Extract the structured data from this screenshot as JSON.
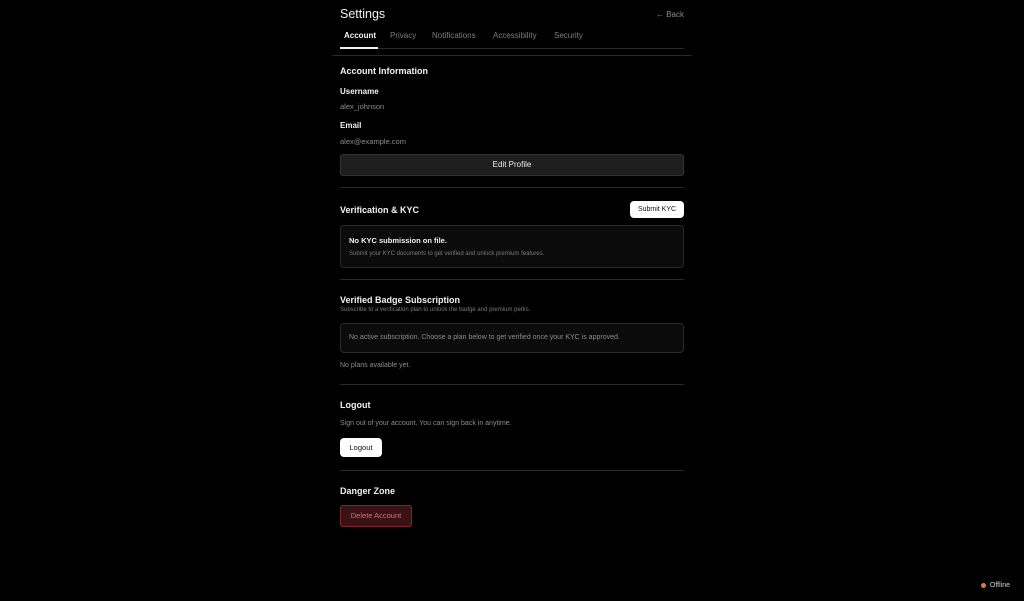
{
  "header": {
    "title": "Settings",
    "back_label": "← Back"
  },
  "tabs": [
    {
      "label": "Account",
      "active": true
    },
    {
      "label": "Privacy",
      "active": false
    },
    {
      "label": "Notifications",
      "active": false
    },
    {
      "label": "Accessibility",
      "active": false
    },
    {
      "label": "Security",
      "active": false
    }
  ],
  "account": {
    "title": "Account Information",
    "username_label": "Username",
    "username_value": "alex_johnson",
    "email_label": "Email",
    "email_value": "alex@example.com",
    "edit_button": "Edit Profile"
  },
  "kyc": {
    "title": "Verification & KYC",
    "submit_button": "Submit KYC",
    "status_title": "No KYC submission on file.",
    "status_desc": "Submit your KYC documents to get verified and unlock premium features."
  },
  "badge": {
    "title": "Verified Badge Subscription",
    "subtitle": "Subscribe to a verification plan to unlock the badge and premium perks.",
    "notice": "No active subscription. Choose a plan below to get verified once your KYC is approved.",
    "no_plans": "No plans available yet."
  },
  "logout": {
    "title": "Logout",
    "desc": "Sign out of your account. You can sign back in anytime.",
    "button": "Logout"
  },
  "danger": {
    "title": "Danger Zone",
    "button": "Delete Account"
  },
  "status": {
    "label": "Offline",
    "color": "#e07a3a"
  }
}
